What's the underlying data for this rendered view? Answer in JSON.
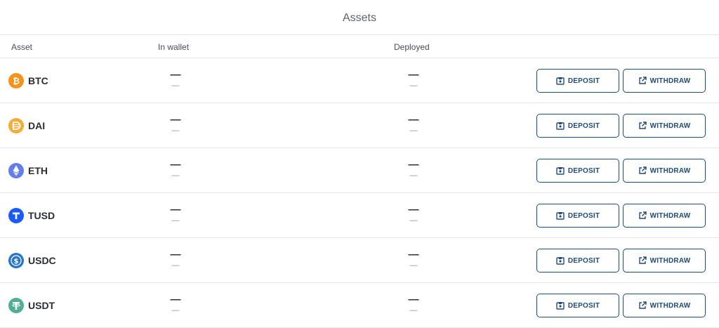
{
  "title": "Assets",
  "columns": {
    "asset": "Asset",
    "wallet": "In wallet",
    "deployed": "Deployed"
  },
  "assets": [
    {
      "symbol": "BTC",
      "icon": "btc-icon",
      "color": "#f7931a",
      "wallet": "—",
      "wallet_sub": "—",
      "deployed": "—",
      "deployed_sub": "—"
    },
    {
      "symbol": "DAI",
      "icon": "dai-icon",
      "color": "#f5ac37",
      "wallet": "—",
      "wallet_sub": "—",
      "deployed": "—",
      "deployed_sub": "—"
    },
    {
      "symbol": "ETH",
      "icon": "eth-icon",
      "color": "#627eea",
      "wallet": "—",
      "wallet_sub": "—",
      "deployed": "—",
      "deployed_sub": "—"
    },
    {
      "symbol": "TUSD",
      "icon": "tusd-icon",
      "color": "#1a5aff",
      "wallet": "—",
      "wallet_sub": "—",
      "deployed": "—",
      "deployed_sub": "—"
    },
    {
      "symbol": "USDC",
      "icon": "usdc-icon",
      "color": "#2775ca",
      "wallet": "—",
      "wallet_sub": "—",
      "deployed": "—",
      "deployed_sub": "—"
    },
    {
      "symbol": "USDT",
      "icon": "usdt-icon",
      "color": "#50af95",
      "wallet": "—",
      "wallet_sub": "—",
      "deployed": "—",
      "deployed_sub": "—"
    }
  ],
  "actions": {
    "deposit": "DEPOSIT",
    "withdraw": "WITHDRAW"
  },
  "accent_color": "#1f4b7a"
}
